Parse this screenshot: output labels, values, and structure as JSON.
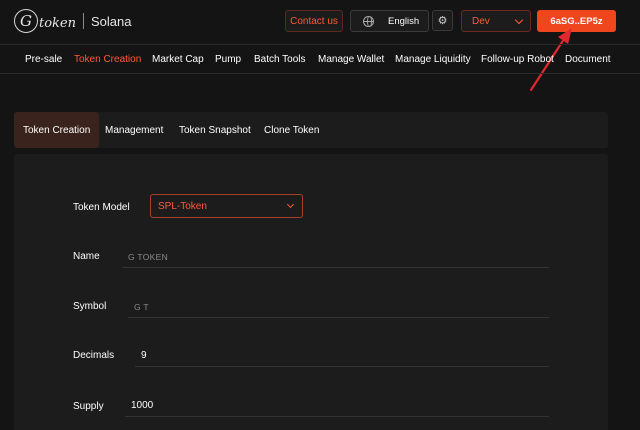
{
  "header": {
    "logo_mark": "G",
    "logo_word": "token",
    "chain": "Solana",
    "contact_label": "Contact us",
    "language": "English",
    "network": "Dev",
    "wallet": "6aSG..EP5z"
  },
  "nav": {
    "items": [
      {
        "label": "Pre-sale"
      },
      {
        "label": "Token Creation"
      },
      {
        "label": "Market Cap"
      },
      {
        "label": "Pump"
      },
      {
        "label": "Batch Tools"
      },
      {
        "label": "Manage Wallet"
      },
      {
        "label": "Manage Liquidity"
      },
      {
        "label": "Follow-up Robot"
      },
      {
        "label": "Document"
      }
    ],
    "active": "Token Creation"
  },
  "subtabs": {
    "items": [
      {
        "label": "Token Creation"
      },
      {
        "label": "Management"
      },
      {
        "label": "Token Snapshot"
      },
      {
        "label": "Clone Token"
      }
    ],
    "active": "Token Creation"
  },
  "form": {
    "model": {
      "label": "Token Model",
      "value": "SPL-Token"
    },
    "name": {
      "label": "Name",
      "placeholder": "G TOKEN"
    },
    "symbol": {
      "label": "Symbol",
      "placeholder": "G T"
    },
    "decimals": {
      "label": "Decimals",
      "value": "9"
    },
    "supply": {
      "label": "Supply",
      "value": "1000"
    }
  },
  "colors": {
    "accent": "#f0461e",
    "background": "#141414",
    "panel": "#1c1c1c",
    "annotation": "#e0282e"
  }
}
